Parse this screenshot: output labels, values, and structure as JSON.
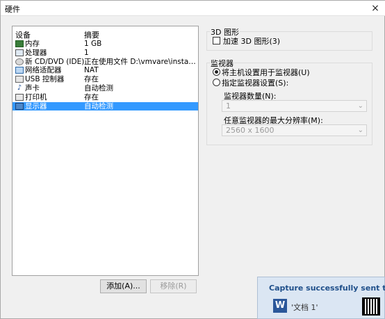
{
  "window": {
    "title": "硬件",
    "close_glyph": "×"
  },
  "device_list": {
    "columns": {
      "device": "设备",
      "summary": "摘要"
    },
    "rows": [
      {
        "icon": "memory-icon",
        "name": "内存",
        "summary": "1 GB"
      },
      {
        "icon": "processor-icon",
        "name": "处理器",
        "summary": "1"
      },
      {
        "icon": "cd-dvd-icon",
        "name": "新 CD/DVD (IDE)",
        "summary": "正在使用文件 D:\\vmvare\\install\\Cen..."
      },
      {
        "icon": "network-adapter-icon",
        "name": "网络适配器",
        "summary": "NAT"
      },
      {
        "icon": "usb-controller-icon",
        "name": "USB 控制器",
        "summary": "存在"
      },
      {
        "icon": "sound-card-icon",
        "name": "声卡",
        "summary": "自动检测"
      },
      {
        "icon": "printer-icon",
        "name": "打印机",
        "summary": "存在"
      },
      {
        "icon": "display-icon",
        "name": "显示器",
        "summary": "自动检测",
        "selected": true
      }
    ]
  },
  "buttons": {
    "add": "添加(A)...",
    "remove": "移除(R)"
  },
  "graphics3d": {
    "group_title": "3D 图形",
    "accelerate_label": "加速 3D 图形(3)",
    "accelerate_checked": false
  },
  "monitors": {
    "group_title": "监视器",
    "option_host": "将主机设置用于监视器(U)",
    "option_specify": "指定监视器设置(S):",
    "selected_option": "host",
    "count_label": "监视器数量(N):",
    "count_value": "1",
    "max_res_label": "任意监视器的最大分辨率(M):",
    "max_res_value": "2560 x 1600"
  },
  "toast": {
    "message": "Capture successfully sent to",
    "app_icon": "W",
    "document": "'文档 1'"
  }
}
